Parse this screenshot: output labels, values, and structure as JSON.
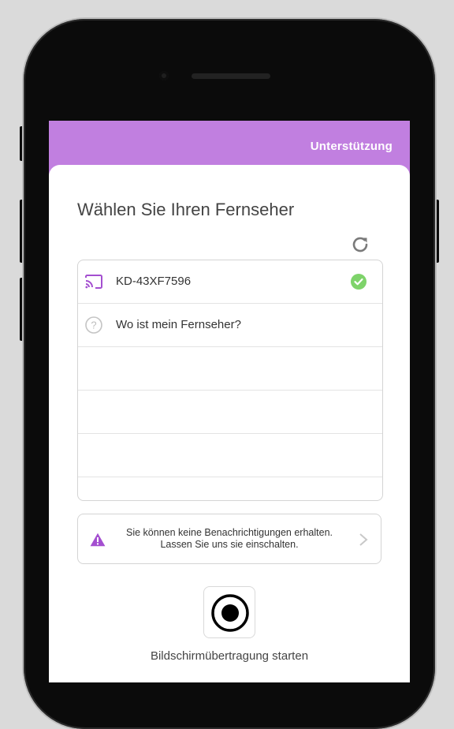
{
  "header": {
    "support_label": "Unterstützung"
  },
  "main": {
    "title": "Wählen Sie Ihren Fernseher",
    "refresh_icon": "refresh-icon",
    "devices": [
      {
        "label": "KD-43XF7596",
        "icon": "cast-icon",
        "status_icon": "check-circle-icon",
        "connected": true
      },
      {
        "label": "Wo ist mein Fernseher?",
        "icon": "help-circle-icon",
        "connected": false
      }
    ],
    "empty_rows": 3
  },
  "notice": {
    "line1": "Sie können keine Benachrichtigungen erhalten.",
    "line2": "Lassen Sie uns sie einschalten.",
    "icon": "warning-icon"
  },
  "record": {
    "label": "Bildschirmübertragung starten",
    "icon": "record-icon"
  },
  "colors": {
    "accent": "#c17fe0",
    "check": "#7ed36a",
    "warning": "#a44fd0"
  }
}
